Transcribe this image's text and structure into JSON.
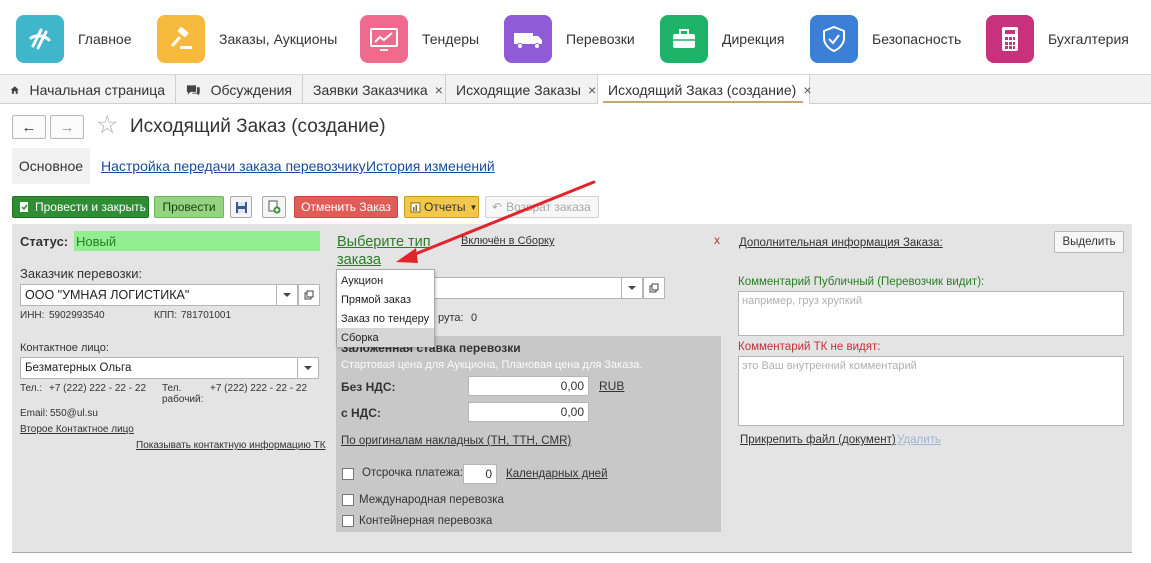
{
  "sections": [
    {
      "label": "Главное",
      "icon": "logo-icon",
      "color": "#3fb6c9"
    },
    {
      "label": "Заказы, Аукционы",
      "icon": "gavel-icon",
      "color": "#f6b93b"
    },
    {
      "label": "Тендеры",
      "icon": "monitor-chart-icon",
      "color": "#f06a8e"
    },
    {
      "label": "Перевозки",
      "icon": "truck-icon",
      "color": "#8f5bd6"
    },
    {
      "label": "Дирекция",
      "icon": "briefcase-icon",
      "color": "#1fb36a"
    },
    {
      "label": "Безопасность",
      "icon": "shield-icon",
      "color": "#3c7fd6"
    },
    {
      "label": "Бухгалтерия",
      "icon": "calculator-icon",
      "color": "#c8327c"
    }
  ],
  "tabs": [
    {
      "label": "Начальная страница",
      "icon": "home-icon"
    },
    {
      "label": "Обсуждения",
      "icon": "chat-icon"
    },
    {
      "label": "Заявки Заказчика",
      "close": "×"
    },
    {
      "label": "Исходящие Заказы",
      "close": "×"
    },
    {
      "label": "Исходящий Заказ (создание)",
      "close": "×"
    }
  ],
  "header": {
    "title": "Исходящий Заказ (создание)",
    "star": "☆",
    "back": "←",
    "forward": "→"
  },
  "subtabs": {
    "main": "Основное",
    "carrier_settings": "Настройка передачи заказа перевозчику",
    "history": "История изменений"
  },
  "toolbar": {
    "post_close": "Провести и закрыть",
    "post": "Провести",
    "cancel_order": "Отменить Заказ",
    "reports": "Отчеты",
    "return_order": "Возврат заказа"
  },
  "form": {
    "status_label": "Статус:",
    "status_value": "Новый",
    "customer_label": "Заказчик перевозки:",
    "customer_value": "ООО \"УМНАЯ ЛОГИСТИКА\"",
    "inn_label": "ИНН:",
    "inn_value": "5902993540",
    "kpp_label": "КПП:",
    "kpp_value": "781701001",
    "contact_label": "Контактное лицо:",
    "contact_value": "Безматерных Ольга",
    "tel_label": "Тел.:",
    "tel_value": "+7 (222) 222 - 22 - 22",
    "tel_work_label": "Тел. рабочий:",
    "tel_work_value": "+7 (222) 222 - 22 - 22",
    "email_label": "Email:",
    "email_value": "550@ul.su",
    "second_contact": "Второе Контактное лицо",
    "show_contact_tk": "Показывать контактную информацию ТК",
    "order_type_link": "Выберите тип заказа",
    "included_link": "Включён в Сборку",
    "close_x": "x",
    "route_fragment": "рута:",
    "route_count": "0",
    "rate_title": "Заложенная ставка перевозки",
    "rate_hint": "Стартовая цена для Аукциона, Плановая цена для Заказа.",
    "no_vat_label": "Без НДС:",
    "no_vat_value": "0,00",
    "currency": "RUB",
    "vat_label": "с НДС:",
    "vat_value": "0,00",
    "originals_link": "По оригиналам накладных (ТН, ТТН, CMR)",
    "deferral_label": "Отсрочка платежа:",
    "deferral_value": "0",
    "calendar_days": "Календарных дней",
    "international": "Международная перевозка",
    "container": "Контейнерная перевозка",
    "additional_info": "Дополнительная информация Заказа:",
    "highlight_btn": "Выделить",
    "public_comment_label": "Комментарий Публичный (Перевозчик видит):",
    "public_comment_placeholder": "например, груз хрупкий",
    "tk_comment_label": "Комментарий ТК не видят:",
    "tk_comment_placeholder": "это Ваш внутренний комментарий",
    "attach_file": "Прикрепить файл (документ)",
    "delete": "Удалить"
  },
  "dropdown_options": [
    "Аукцион",
    "Прямой заказ",
    "Заказ по тендеру",
    "Сборка"
  ],
  "colors": {
    "link": "#1a4a9c",
    "green_link": "#2a7d25",
    "red_label": "#c0313a",
    "annotation_arrow": "#e0262b"
  }
}
